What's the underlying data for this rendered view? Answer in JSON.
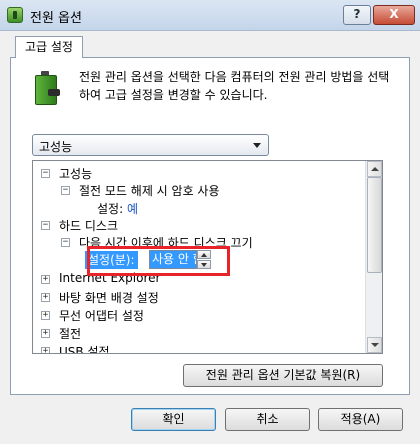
{
  "window": {
    "title": "전원 옵션",
    "help_label": "?",
    "close_label": "X"
  },
  "tab": {
    "label": "고급 설정"
  },
  "description": "전원 관리 옵션을 선택한 다음 컴퓨터의 전원 관리 방법을 선택하여 고급 설정을 변경할 수 있습니다.",
  "plan_select": {
    "value": "고성능"
  },
  "tree": {
    "items": [
      {
        "expander": "⊟",
        "label": "고성능"
      },
      {
        "expander": "⊟",
        "label": "절전 모드 해제 시 암호 사용"
      },
      {
        "label": "설정:",
        "value": "예"
      },
      {
        "expander": "⊟",
        "label": "하드 디스크"
      },
      {
        "expander": "⊟",
        "label": "다음 시간 이후에 하드 디스크 끄기"
      },
      {
        "expander": "⊞",
        "label": "Internet Explorer"
      },
      {
        "expander": "⊞",
        "label": "바탕 화면 배경 설정"
      },
      {
        "expander": "⊞",
        "label": "무선 어댑터 설정"
      },
      {
        "expander": "⊞",
        "label": "절전"
      },
      {
        "expander": "⊞",
        "label": "USB 설정"
      }
    ],
    "spin": {
      "label": "설정(분):",
      "value": "사용 안 함"
    }
  },
  "buttons": {
    "restore": "전원 관리 옵션 기본값 복원(R)",
    "ok": "확인",
    "cancel": "취소",
    "apply": "적용(A)"
  }
}
